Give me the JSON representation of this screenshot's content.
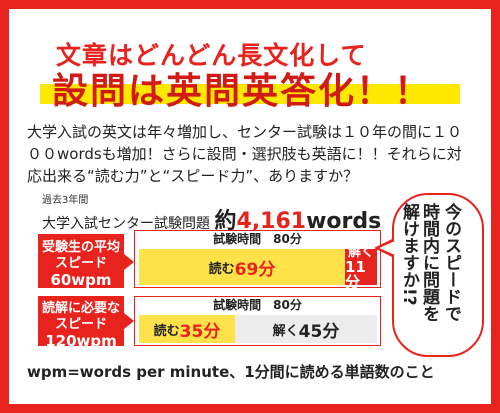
{
  "heading": {
    "line1": "文章はどんどん長文化して",
    "line2": "設問は英問英答化！！"
  },
  "body_text": "大学入試の英文は年々増加し、センター試験は１０年の間に１０００wordsも増加！さらに設問・選択肢も英語に！！それらに対応出来る“読む力”と“スピード力”、ありますか？",
  "stats": {
    "small_label": "過去3年間",
    "label": "大学入試センター試験問題",
    "approx": "約",
    "count": "4,161",
    "unit": "words"
  },
  "rows": [
    {
      "label_line1": "受験生の平均",
      "label_line2": "スピード",
      "speed": "60wpm",
      "header": "試験時間　80分",
      "read_label": "読む",
      "read_value": "69分",
      "solve_label": "解く",
      "solve_value": "11分"
    },
    {
      "label_line1": "読解に必要な",
      "label_line2": "スピード",
      "speed": "120wpm",
      "header": "試験時間　80分",
      "read_label": "読む",
      "read_value": "35分",
      "solve_label": "解く",
      "solve_value": "45分"
    }
  ],
  "bubble": {
    "col1": "今のスピードで",
    "col2": "時間内に問題を",
    "col3": "解けますか!?"
  },
  "footer": "wpm=words per minute、1分間に読める単語数のこと",
  "colors": {
    "accent_red": "#e8231d",
    "highlight_yellow": "#ffe800",
    "bar_yellow": "#ffe24a",
    "bar_gray": "#ececec"
  }
}
